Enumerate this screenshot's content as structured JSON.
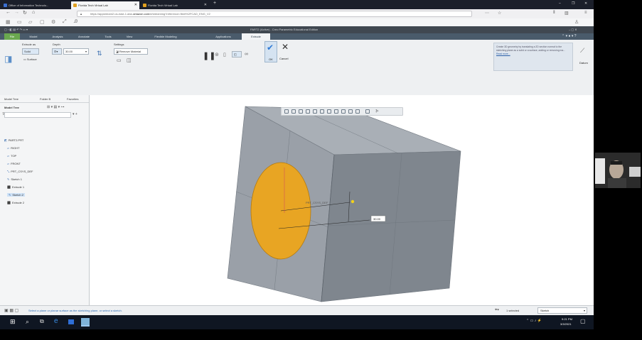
{
  "browser": {
    "tabs": [
      {
        "label": "Office of Information Technolo...",
        "active": false
      },
      {
        "label": "Florida Tech Virtual Lab",
        "active": true
      },
      {
        "label": "Florida Tech Virtual Lab",
        "active": false
      }
    ],
    "new_tab_glyph": "+",
    "window_controls": [
      "–",
      "❐",
      "✕"
    ],
    "url_prefix": "https://appstream2.us-east-1.aws.",
    "url_domain": "amazon.com",
    "url_suffix": "/#/streaming?reference=fleet%2FCAD_ENG_V2"
  },
  "creo": {
    "title": "PART2 (Active) - Creo Parametric Educational Edition",
    "ribbon_tabs": [
      "File",
      "Model",
      "Analysis",
      "Annotate",
      "Tools",
      "View",
      "Flexible Modeling",
      "Applications",
      "Extrude"
    ],
    "extrude_as_label": "Extrude as",
    "solid_label": "Solid",
    "surface_label": "Surface",
    "depth_label": "Depth",
    "depth_value": "30.00",
    "settings_label": "Settings",
    "remove_material_label": "Remove Material",
    "ok_label": "OK",
    "cancel_label": "Cancel",
    "help_text": "Create 3D geometry by translating a 2D section normal to the sketching plane as a solid or a surface, adding or removing ma...",
    "read_more_label": "Read more...",
    "datum_label": "Datum",
    "subtabs": [
      "Placement",
      "Options",
      "Properties"
    ]
  },
  "model_tree": {
    "panel_tabs": [
      "Model Tree",
      "Folder B",
      "Favorites"
    ],
    "header": "Model Tree",
    "items": [
      {
        "label": "PART2.PRT",
        "indent": 0
      },
      {
        "label": "RIGHT",
        "indent": 1
      },
      {
        "label": "TOP",
        "indent": 1
      },
      {
        "label": "FRONT",
        "indent": 1
      },
      {
        "label": "PRT_CSYS_DEF",
        "indent": 1
      },
      {
        "label": "Sketch 1",
        "indent": 1
      },
      {
        "label": "Extrude 1",
        "indent": 1
      },
      {
        "label": "Sketch 2",
        "indent": 1,
        "selected": true
      },
      {
        "label": "Extrude 2",
        "indent": 1
      }
    ]
  },
  "graphics": {
    "dimension_value": "30.00"
  },
  "status": {
    "message": "Select a plane or planar surface as the sketching plane, or select a sketch.",
    "selected_label": "1 selected",
    "filter_value": "Sketch"
  },
  "taskbar": {
    "time": "9:21 PM",
    "date": "3/3/2021"
  },
  "colors": {
    "cube_front": "#9aa0a8",
    "cube_top": "#a9afb6",
    "cube_side": "#7f868e",
    "hole_fill": "#e8a523",
    "creo_green": "#6aa84f"
  }
}
